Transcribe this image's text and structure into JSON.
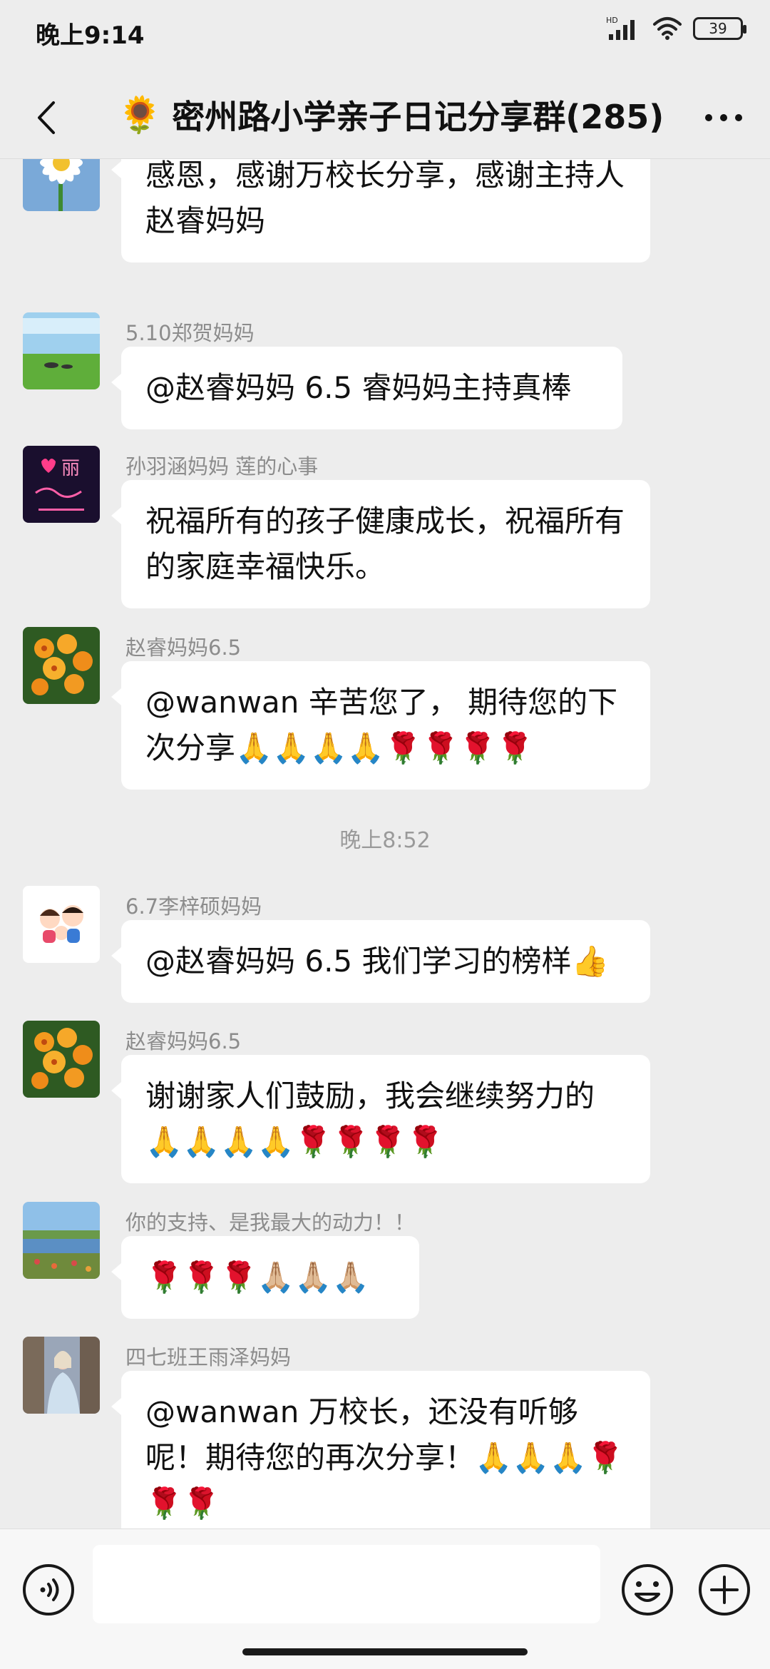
{
  "status_bar": {
    "time": "晚上9:14",
    "battery": "39",
    "hd_label": "HD"
  },
  "header": {
    "title_emoji": "🌻",
    "title": "密州路小学亲子日记分享群(285)",
    "more_label": "···"
  },
  "messages": [
    {
      "sender": "",
      "text": "感恩，感谢万校长分享，感谢主持人赵睿妈妈",
      "avatar": "daisy-avatar"
    },
    {
      "sender": "5.10郑贺妈妈",
      "text": "@赵睿妈妈 6.5  睿妈妈主持真棒",
      "avatar": "grassland-avatar"
    },
    {
      "sender": "孙羽涵妈妈  莲的心事",
      "text": "祝福所有的孩子健康成长，祝福所有的家庭幸福快乐。",
      "avatar": "neon-avatar"
    },
    {
      "sender": "赵睿妈妈6.5",
      "text": "@wanwan 辛苦您了， 期待您的下次分享🙏🙏🙏🙏🌹🌹🌹🌹",
      "avatar": "flower-avatar"
    },
    {
      "sender": "6.7李梓硕妈妈",
      "text": "@赵睿妈妈 6.5  我们学习的榜样👍",
      "avatar": "cartoon-family-avatar"
    },
    {
      "sender": "赵睿妈妈6.5",
      "text": "谢谢家人们鼓励，我会继续努力的🙏🙏🙏🙏🌹🌹🌹🌹",
      "avatar": "flower-avatar"
    },
    {
      "sender": "你的支持、是我最大的动力！！",
      "text": "🌹🌹🌹🙏🏼🙏🏼🙏🏼",
      "avatar": "lake-avatar"
    },
    {
      "sender": "四七班王雨泽妈妈",
      "text": "@wanwan  万校长，还没有听够呢！期待您的再次分享！🙏🙏🙏🌹🌹🌹",
      "avatar": "portrait-avatar"
    }
  ],
  "time_separator": "晚上8:52",
  "input": {
    "placeholder": ""
  },
  "colors": {
    "background": "#ededed",
    "bubble": "#ffffff",
    "sender": "#8c8c8c"
  }
}
